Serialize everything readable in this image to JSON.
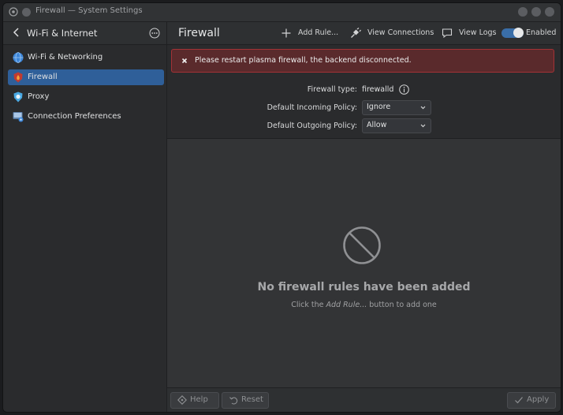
{
  "window": {
    "title": "Firewall — System Settings"
  },
  "sidebar": {
    "header": "Wi-Fi & Internet",
    "items": [
      {
        "label": "Wi-Fi & Networking",
        "icon": "globe-icon",
        "active": false
      },
      {
        "label": "Firewall",
        "icon": "firewall-icon",
        "active": true
      },
      {
        "label": "Proxy",
        "icon": "proxy-icon",
        "active": false
      },
      {
        "label": "Connection Preferences",
        "icon": "connection-preferences-icon",
        "active": false
      }
    ]
  },
  "header": {
    "title": "Firewall",
    "add_rule": "Add Rule...",
    "view_connections": "View Connections",
    "view_logs": "View Logs",
    "enabled_label": "Enabled",
    "enabled": true
  },
  "banner": {
    "message": "Please restart plasma firewall, the backend disconnected."
  },
  "settings": {
    "type_label": "Firewall type:",
    "type_value": "firewalld",
    "incoming_label": "Default Incoming Policy:",
    "incoming_value": "Ignore",
    "outgoing_label": "Default Outgoing Policy:",
    "outgoing_value": "Allow"
  },
  "empty_state": {
    "title": "No firewall rules have been added",
    "sub_prefix": "Click the ",
    "sub_emph": "Add Rule...",
    "sub_suffix": " button to add one"
  },
  "footer": {
    "help": "Help",
    "reset": "Reset",
    "apply": "Apply"
  },
  "colors": {
    "accent": "#2f5f99",
    "error_border": "#a33236",
    "error_bg": "#5a2a2c",
    "toggle_on": "#3a6ea8"
  }
}
